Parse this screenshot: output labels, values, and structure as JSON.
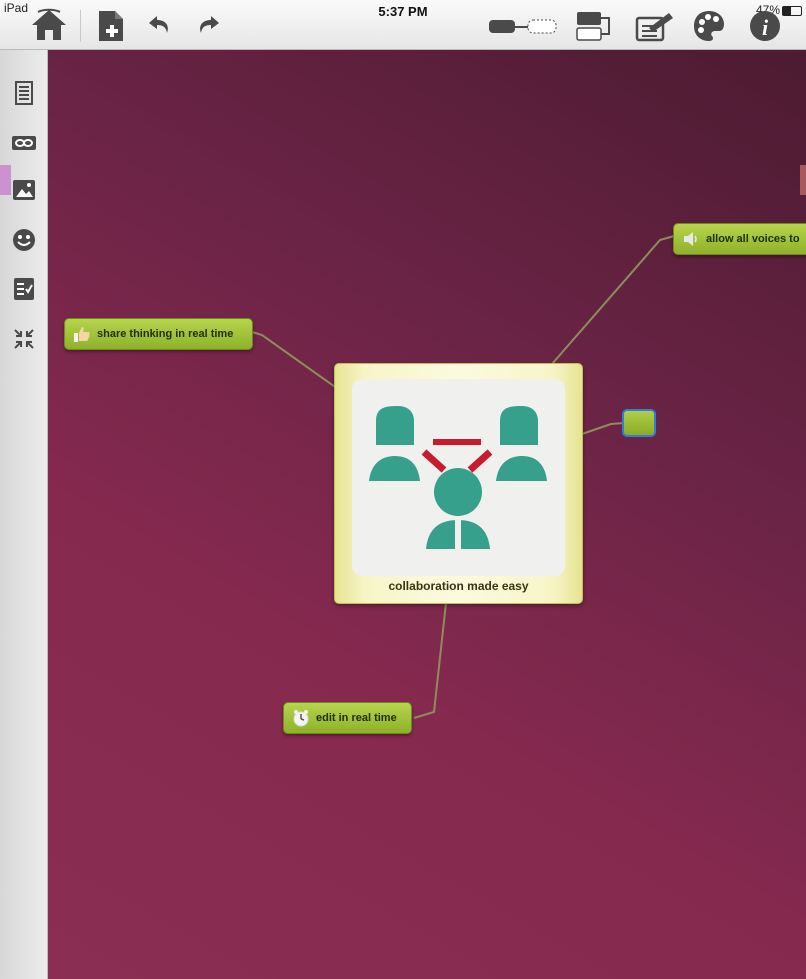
{
  "status_bar": {
    "device": "iPad",
    "time": "5:37 PM",
    "battery": "47%"
  },
  "toolbar": {
    "icons": [
      "home-icon",
      "new-document-icon",
      "undo-icon",
      "redo-icon",
      "link-tool-icon",
      "layout-icon",
      "export-icon",
      "palette-icon",
      "info-icon"
    ]
  },
  "sidebar": {
    "items": [
      "notes-icon",
      "link-icon",
      "image-icon",
      "emoji-icon",
      "task-list-icon",
      "collapse-icon"
    ]
  },
  "mindmap": {
    "central": {
      "label": "collaboration made easy",
      "image": "people-collaboration-icon",
      "colors": {
        "people": "#36a08c",
        "links": "#c81c2c"
      }
    },
    "nodes": [
      {
        "label": "share thinking in real time",
        "icon": "thumbs-up-icon"
      },
      {
        "label": "allow all voices to",
        "icon": "speaker-icon"
      },
      {
        "label": "edit in real time",
        "icon": "clock-icon"
      },
      {
        "label": ""
      }
    ],
    "colors": {
      "background": "#7a2548",
      "node": "#9dbd33",
      "connector": "#8a8a5a",
      "selection": "#2e7fd8"
    }
  }
}
